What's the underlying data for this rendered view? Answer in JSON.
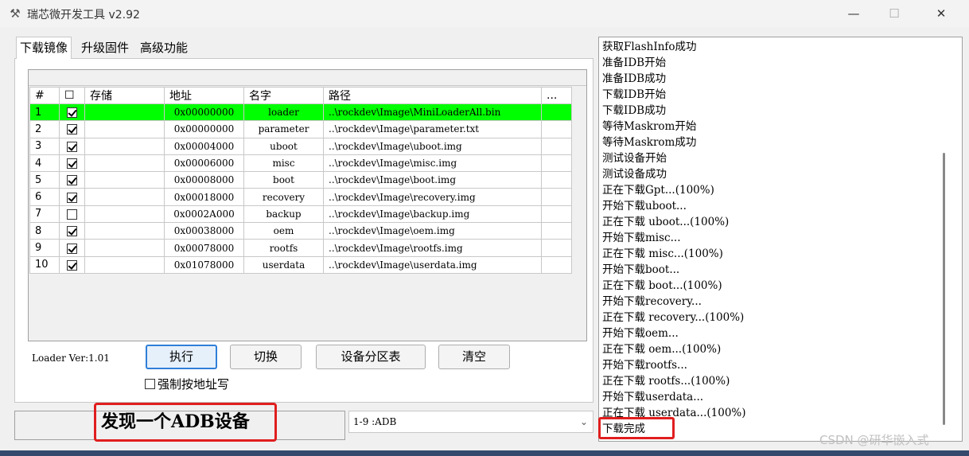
{
  "window": {
    "title": "瑞芯微开发工具 v2.92",
    "app_icon": "tools-icon",
    "min_glyph": "—",
    "max_glyph": "☐",
    "close_glyph": "✕"
  },
  "tabs": [
    "下载镜像",
    "升级固件",
    "高级功能"
  ],
  "table": {
    "columns": [
      "#",
      "☐",
      "存储",
      "地址",
      "名字",
      "路径",
      "..."
    ],
    "rows": [
      {
        "num": "1",
        "checked": true,
        "storage": "",
        "address": "0x00000000",
        "name": "loader",
        "path": "..\\rockdev\\Image\\MiniLoaderAll.bin",
        "highlight": true
      },
      {
        "num": "2",
        "checked": true,
        "storage": "",
        "address": "0x00000000",
        "name": "parameter",
        "path": "..\\rockdev\\Image\\parameter.txt",
        "highlight": false
      },
      {
        "num": "3",
        "checked": true,
        "storage": "",
        "address": "0x00004000",
        "name": "uboot",
        "path": "..\\rockdev\\Image\\uboot.img",
        "highlight": false
      },
      {
        "num": "4",
        "checked": true,
        "storage": "",
        "address": "0x00006000",
        "name": "misc",
        "path": "..\\rockdev\\Image\\misc.img",
        "highlight": false
      },
      {
        "num": "5",
        "checked": true,
        "storage": "",
        "address": "0x00008000",
        "name": "boot",
        "path": "..\\rockdev\\Image\\boot.img",
        "highlight": false
      },
      {
        "num": "6",
        "checked": true,
        "storage": "",
        "address": "0x00018000",
        "name": "recovery",
        "path": "..\\rockdev\\Image\\recovery.img",
        "highlight": false
      },
      {
        "num": "7",
        "checked": false,
        "storage": "",
        "address": "0x0002A000",
        "name": "backup",
        "path": "..\\rockdev\\Image\\backup.img",
        "highlight": false
      },
      {
        "num": "8",
        "checked": true,
        "storage": "",
        "address": "0x00038000",
        "name": "oem",
        "path": "..\\rockdev\\Image\\oem.img",
        "highlight": false
      },
      {
        "num": "9",
        "checked": true,
        "storage": "",
        "address": "0x00078000",
        "name": "rootfs",
        "path": "..\\rockdev\\Image\\rootfs.img",
        "highlight": false
      },
      {
        "num": "10",
        "checked": true,
        "storage": "",
        "address": "0x01078000",
        "name": "userdata",
        "path": "..\\rockdev\\Image\\userdata.img",
        "highlight": false
      }
    ]
  },
  "loader_version": "Loader Ver:1.01",
  "buttons": {
    "execute": "执行",
    "switch": "切换",
    "partition_table": "设备分区表",
    "clear": "清空"
  },
  "force_write_label": "强制按地址写",
  "status_message": "发现一个ADB设备",
  "device_select": {
    "value": "1-9 :ADB"
  },
  "log": [
    "获取FlashInfo成功",
    "准备IDB开始",
    "准备IDB成功",
    "下载IDB开始",
    "下载IDB成功",
    "等待Maskrom开始",
    "等待Maskrom成功",
    "测试设备开始",
    "测试设备成功",
    "正在下载Gpt...(100%)",
    "开始下载uboot...",
    "正在下载 uboot...(100%)",
    "开始下载misc...",
    "正在下载 misc...(100%)",
    "开始下载boot...",
    "正在下载 boot...(100%)",
    "开始下载recovery...",
    "正在下载 recovery...(100%)",
    "开始下载oem...",
    "正在下载 oem...(100%)",
    "开始下载rootfs...",
    "正在下载 rootfs...(100%)",
    "开始下载userdata...",
    "正在下载 userdata...(100%)",
    "下载完成"
  ],
  "watermark": "CSDN @研华嵌入式",
  "colors": {
    "highlight_row": "#00ff00",
    "annotation_red": "#e01e1e",
    "primary_button_border": "#2f7fd8"
  }
}
